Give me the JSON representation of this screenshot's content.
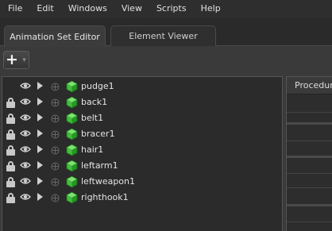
{
  "menubar": [
    "File",
    "Edit",
    "Windows",
    "View",
    "Scripts",
    "Help"
  ],
  "tabs": {
    "active": "Animation Set Editor",
    "inactive": "Element Viewer"
  },
  "toolbar": {
    "add_glyph": "+",
    "dropdown_glyph": "▾"
  },
  "tree": {
    "items": [
      {
        "label": "pudge1",
        "locked": false
      },
      {
        "label": "back1",
        "locked": true
      },
      {
        "label": "belt1",
        "locked": true
      },
      {
        "label": "bracer1",
        "locked": true
      },
      {
        "label": "hair1",
        "locked": true
      },
      {
        "label": "leftarm1",
        "locked": true
      },
      {
        "label": "leftweapon1",
        "locked": true
      },
      {
        "label": "righthook1",
        "locked": true
      }
    ]
  },
  "right_panel": {
    "header": "Procedural"
  },
  "icons": {
    "row": [
      "lock-icon",
      "eye-icon",
      "play-arrow-icon",
      "expand-icon",
      "cube-icon"
    ]
  },
  "colors": {
    "cube_green": "#3fbf3a",
    "panel_bg": "#2b2b2b",
    "menubar_bg": "#2e2e2e"
  }
}
